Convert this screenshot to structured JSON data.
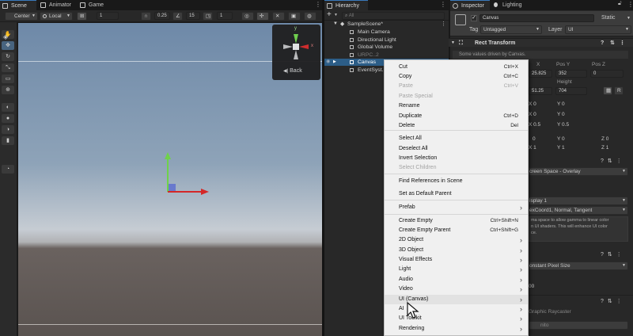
{
  "scene_tabs": [
    {
      "label": "Scene",
      "icon": "scene-icon",
      "active": true
    },
    {
      "label": "Animator",
      "icon": "animator-icon",
      "active": false
    },
    {
      "label": "Game",
      "icon": "game-icon",
      "active": false
    }
  ],
  "scene_toolbar": {
    "pivot": "Center",
    "space": "Local",
    "grid_value": "1",
    "snap_value": "0.25",
    "angle_value": "15",
    "scale_value": "1"
  },
  "gizmo": {
    "axis_y": "y",
    "axis_x": "x",
    "back_label": "Back"
  },
  "hierarchy": {
    "tab_label": "Hierarchy",
    "add_label": "+",
    "search_placeholder": "All",
    "scene_name": "SampleScene*",
    "items": [
      "Main Camera",
      "Directional Light",
      "Global Volume",
      "URPC..2",
      "Canvas",
      "EventSyst..."
    ]
  },
  "context_menu": {
    "items": [
      {
        "label": "Cut",
        "shortcut": "Ctrl+X",
        "disabled": false,
        "submenu": false
      },
      {
        "label": "Copy",
        "shortcut": "Ctrl+C",
        "disabled": false,
        "submenu": false
      },
      {
        "label": "Paste",
        "shortcut": "Ctrl+V",
        "disabled": true,
        "submenu": false
      },
      {
        "label": "Paste Special",
        "shortcut": "",
        "disabled": true,
        "submenu": false
      },
      {
        "label": "Rename",
        "shortcut": "",
        "disabled": false,
        "submenu": false
      },
      {
        "label": "Duplicate",
        "shortcut": "Ctrl+D",
        "disabled": false,
        "submenu": false
      },
      {
        "label": "Delete",
        "shortcut": "Del",
        "disabled": false,
        "submenu": false
      },
      {
        "label": "Select All",
        "shortcut": "",
        "disabled": false,
        "submenu": false
      },
      {
        "label": "Deselect All",
        "shortcut": "",
        "disabled": false,
        "submenu": false
      },
      {
        "label": "Invert Selection",
        "shortcut": "",
        "disabled": false,
        "submenu": false
      },
      {
        "label": "Select Children",
        "shortcut": "",
        "disabled": true,
        "submenu": false
      },
      {
        "label": "Find References in Scene",
        "shortcut": "",
        "disabled": false,
        "submenu": false
      },
      {
        "label": "Set as Default Parent",
        "shortcut": "",
        "disabled": false,
        "submenu": false
      },
      {
        "label": "Prefab",
        "shortcut": "",
        "disabled": false,
        "submenu": true
      },
      {
        "label": "Create Empty",
        "shortcut": "Ctrl+Shift+N",
        "disabled": false,
        "submenu": false
      },
      {
        "label": "Create Empty Parent",
        "shortcut": "Ctrl+Shift+G",
        "disabled": false,
        "submenu": false
      },
      {
        "label": "2D Object",
        "shortcut": "",
        "disabled": false,
        "submenu": true
      },
      {
        "label": "3D Object",
        "shortcut": "",
        "disabled": false,
        "submenu": true
      },
      {
        "label": "Visual Effects",
        "shortcut": "",
        "disabled": false,
        "submenu": true
      },
      {
        "label": "Light",
        "shortcut": "",
        "disabled": false,
        "submenu": true
      },
      {
        "label": "Audio",
        "shortcut": "",
        "disabled": false,
        "submenu": true
      },
      {
        "label": "Video",
        "shortcut": "",
        "disabled": false,
        "submenu": true
      },
      {
        "label": "UI (Canvas)",
        "shortcut": "",
        "disabled": false,
        "submenu": true
      },
      {
        "label": "AI",
        "shortcut": "",
        "disabled": false,
        "submenu": true
      },
      {
        "label": "UI Toolkit",
        "shortcut": "",
        "disabled": false,
        "submenu": true
      },
      {
        "label": "Rendering",
        "shortcut": "",
        "disabled": false,
        "submenu": true
      }
    ]
  },
  "inspector": {
    "tab_inspector": "Inspector",
    "tab_lighting": "Lighting",
    "object_name": "Canvas",
    "static_label": "Static",
    "tag_label": "Tag",
    "tag_value": "Untagged",
    "layer_label": "Layer",
    "layer_value": "UI",
    "rect_transform": "Rect Transform",
    "driven_note": "Some values driven by Canvas.",
    "pos_x_label": "X",
    "pos_y_label": "Pos Y",
    "pos_z_label": "Pos Z",
    "pos_x": "25.825",
    "pos_y": "352",
    "pos_z": "0",
    "height_label": "Height",
    "width_value": "51.25",
    "height_value": "704",
    "r_btn": "R",
    "row_x0": "X 0",
    "row_y0": "Y 0",
    "row_x05": "X 0.5",
    "row_y05": "Y 0.5",
    "row_x1": "X 1",
    "row_y1": "Y 1",
    "row_z1": "Z 1",
    "row_y0b": "Y 0",
    "row_z0": "Z 0",
    "row_0": "0",
    "render_mode": "creen Space - Overlay",
    "display": "isplay 1",
    "channels": "exCoord1, Normal, Tangent",
    "shader_note_1": "ma space to allow gamma to linear color",
    "shader_note_2": "n UI shaders. This will enhance UI color",
    "shader_note_3": "ce.",
    "scale_mode": "onstant Pixel Size",
    "scale_value": "00",
    "raycaster": "Graphic Raycaster",
    "raycaster_hint": "nito",
    "q_icon": "?",
    "menu_dots": "⋮"
  },
  "colors": {
    "sky_top": "#6f8aa8",
    "sky_horizon": "#b9c1cc",
    "ground": "#5c5552",
    "accent": "#3a79bb",
    "menu_bg": "#f0f0f0"
  }
}
